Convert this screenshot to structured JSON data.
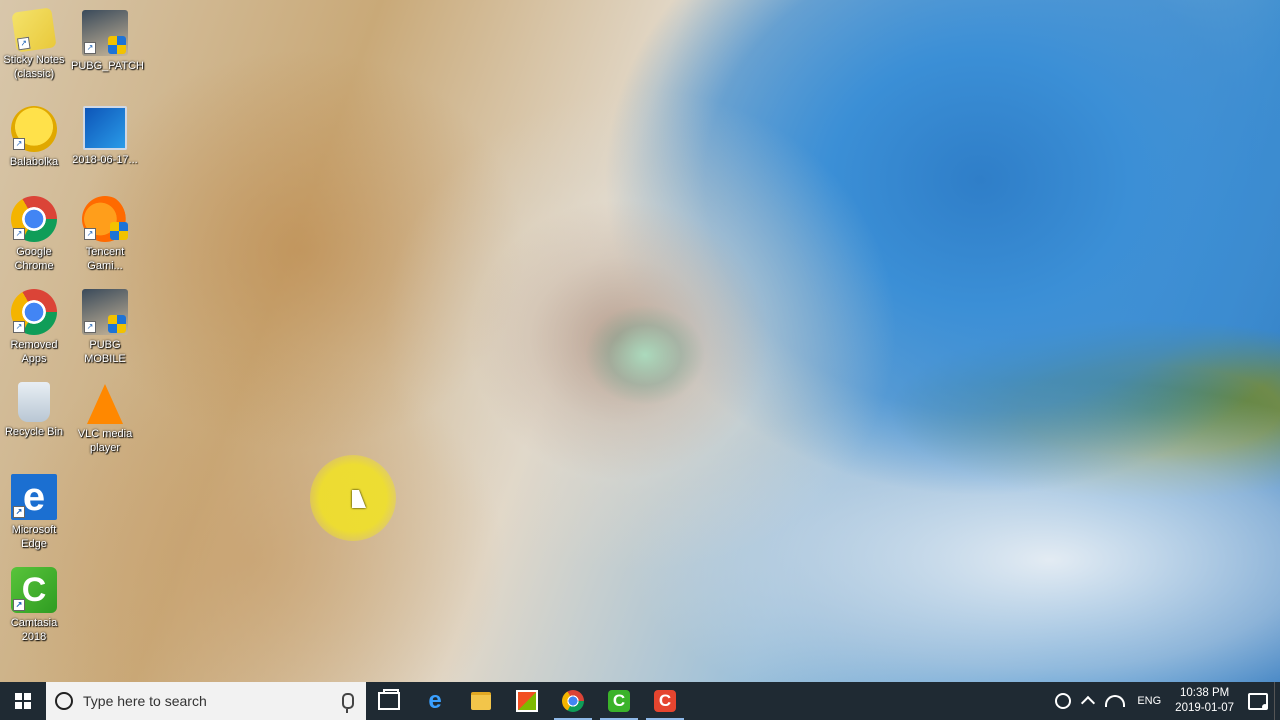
{
  "desktop": {
    "icons": [
      {
        "label": "Sticky Notes (classic)",
        "icon": "sticky-notes-icon"
      },
      {
        "label": "PUBG_PATCH",
        "icon": "pubg-patch-icon"
      },
      {
        "label": "Balabolka",
        "icon": "balabolka-icon"
      },
      {
        "label": "2018-06-17...",
        "icon": "windows-setup-icon"
      },
      {
        "label": "Google Chrome",
        "icon": "chrome-icon"
      },
      {
        "label": "Tencent Gami...",
        "icon": "tencent-gaming-icon"
      },
      {
        "label": "Removed Apps",
        "icon": "chrome-icon"
      },
      {
        "label": "PUBG MOBILE",
        "icon": "pubg-mobile-icon"
      },
      {
        "label": "Recycle Bin",
        "icon": "recycle-bin-icon"
      },
      {
        "label": "VLC media player",
        "icon": "vlc-icon"
      },
      {
        "label": "Microsoft Edge",
        "icon": "edge-icon"
      },
      {
        "label": "Camtasia 2018",
        "icon": "camtasia-icon"
      }
    ]
  },
  "taskbar": {
    "search_placeholder": "Type here to search",
    "pinned": [
      "task-view",
      "microsoft-edge",
      "file-explorer",
      "microsoft-store",
      "google-chrome",
      "camtasia",
      "camtasia-recorder"
    ],
    "language": "ENG",
    "time": "10:38 PM",
    "date": "2019-01-07"
  },
  "colors": {
    "taskbar_bg": "#1f2a33",
    "search_bg": "#f2f2f2",
    "cursor_highlight": "#f0e128"
  }
}
